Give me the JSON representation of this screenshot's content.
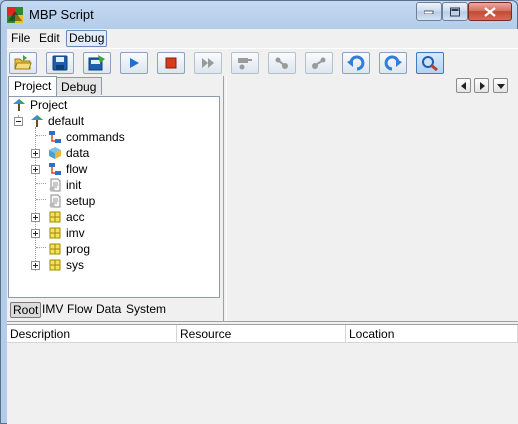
{
  "window": {
    "title": "MBP Script",
    "controls": [
      "minimize",
      "maximize",
      "close"
    ]
  },
  "menu": {
    "file": "File",
    "edit": "Edit",
    "debug": "Debug"
  },
  "toolbar": {
    "buttons": [
      {
        "name": "open-icon",
        "state": "enabled"
      },
      {
        "name": "save-icon",
        "state": "enabled"
      },
      {
        "name": "export-icon",
        "state": "enabled"
      },
      {
        "name": "run-icon",
        "state": "enabled"
      },
      {
        "name": "stop-icon",
        "state": "enabled"
      },
      {
        "name": "fast-forward-icon",
        "state": "disabled"
      },
      {
        "name": "step-over-icon",
        "state": "disabled"
      },
      {
        "name": "step-into-icon",
        "state": "disabled"
      },
      {
        "name": "step-out-icon",
        "state": "disabled"
      },
      {
        "name": "undo-icon",
        "state": "enabled"
      },
      {
        "name": "redo-icon",
        "state": "enabled"
      },
      {
        "name": "search-icon",
        "state": "active"
      }
    ]
  },
  "left_panel": {
    "tabs": [
      "Project",
      "Debug"
    ],
    "selected_tab": "Project",
    "tree": {
      "root": "Project",
      "default": "default",
      "children": [
        {
          "label": "commands",
          "icon": "flow-icon",
          "expandable": false
        },
        {
          "label": "data",
          "icon": "cube-icon",
          "expandable": true
        },
        {
          "label": "flow",
          "icon": "flow-icon",
          "expandable": true
        },
        {
          "label": "init",
          "icon": "script-icon",
          "expandable": false
        },
        {
          "label": "setup",
          "icon": "script-icon",
          "expandable": false
        },
        {
          "label": "acc",
          "icon": "grid-icon",
          "expandable": true
        },
        {
          "label": "imv",
          "icon": "grid-icon",
          "expandable": true
        },
        {
          "label": "prog",
          "icon": "grid-icon",
          "expandable": false
        },
        {
          "label": "sys",
          "icon": "grid-icon",
          "expandable": true
        }
      ]
    },
    "bottom_tabs": [
      "Root",
      "IMV",
      "Flow",
      "Data",
      "System"
    ],
    "selected_bottom_tab": "Root"
  },
  "problems_table": {
    "columns": [
      "Description",
      "Resource",
      "Location"
    ]
  },
  "colors": {
    "titlebar": "#b3cde9",
    "client_bg": "#f0f0f0",
    "tree_bg": "#ffffff",
    "grid_icon": "#c9b400",
    "run_blue": "#1d6fd1",
    "stop_red": "#d83a1a"
  }
}
